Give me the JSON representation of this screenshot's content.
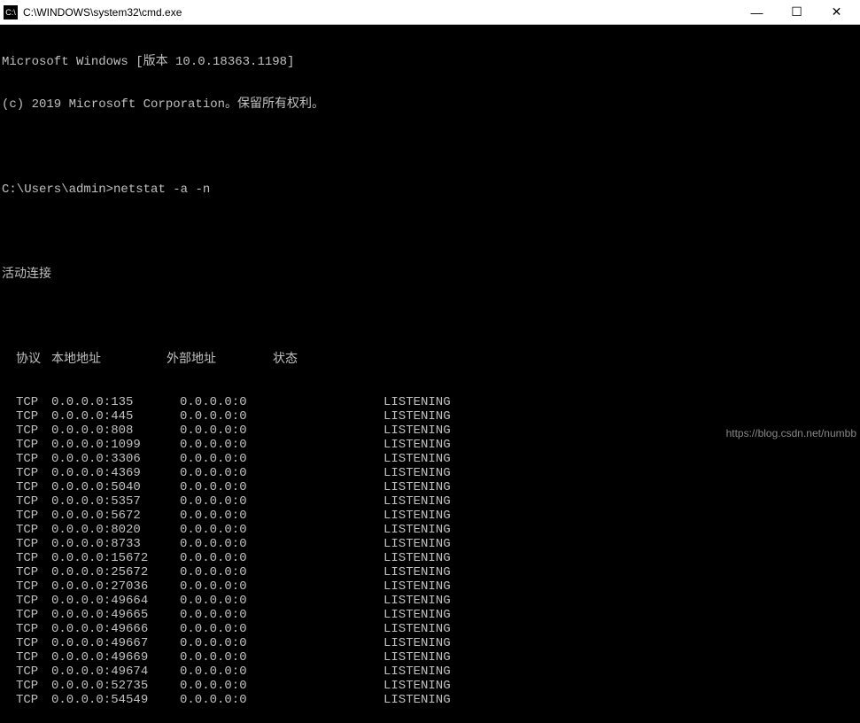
{
  "window": {
    "icon_label": "C:\\",
    "title": "C:\\WINDOWS\\system32\\cmd.exe",
    "minimize": "—",
    "maximize": "☐",
    "close": "✕"
  },
  "banner": {
    "line1": "Microsoft Windows [版本 10.0.18363.1198]",
    "line2": "(c) 2019 Microsoft Corporation。保留所有权利。"
  },
  "prompt": {
    "path": "C:\\Users\\admin>",
    "command": "netstat -a -n"
  },
  "section_title": "活动连接",
  "headers": {
    "proto": "协议",
    "local": "本地地址",
    "foreign": "外部地址",
    "state": "状态"
  },
  "rows": [
    {
      "proto": "TCP",
      "local": "0.0.0.0:135",
      "foreign": "0.0.0.0:0",
      "state": "LISTENING"
    },
    {
      "proto": "TCP",
      "local": "0.0.0.0:445",
      "foreign": "0.0.0.0:0",
      "state": "LISTENING"
    },
    {
      "proto": "TCP",
      "local": "0.0.0.0:808",
      "foreign": "0.0.0.0:0",
      "state": "LISTENING"
    },
    {
      "proto": "TCP",
      "local": "0.0.0.0:1099",
      "foreign": "0.0.0.0:0",
      "state": "LISTENING"
    },
    {
      "proto": "TCP",
      "local": "0.0.0.0:3306",
      "foreign": "0.0.0.0:0",
      "state": "LISTENING"
    },
    {
      "proto": "TCP",
      "local": "0.0.0.0:4369",
      "foreign": "0.0.0.0:0",
      "state": "LISTENING"
    },
    {
      "proto": "TCP",
      "local": "0.0.0.0:5040",
      "foreign": "0.0.0.0:0",
      "state": "LISTENING"
    },
    {
      "proto": "TCP",
      "local": "0.0.0.0:5357",
      "foreign": "0.0.0.0:0",
      "state": "LISTENING"
    },
    {
      "proto": "TCP",
      "local": "0.0.0.0:5672",
      "foreign": "0.0.0.0:0",
      "state": "LISTENING"
    },
    {
      "proto": "TCP",
      "local": "0.0.0.0:8020",
      "foreign": "0.0.0.0:0",
      "state": "LISTENING"
    },
    {
      "proto": "TCP",
      "local": "0.0.0.0:8733",
      "foreign": "0.0.0.0:0",
      "state": "LISTENING"
    },
    {
      "proto": "TCP",
      "local": "0.0.0.0:15672",
      "foreign": "0.0.0.0:0",
      "state": "LISTENING"
    },
    {
      "proto": "TCP",
      "local": "0.0.0.0:25672",
      "foreign": "0.0.0.0:0",
      "state": "LISTENING"
    },
    {
      "proto": "TCP",
      "local": "0.0.0.0:27036",
      "foreign": "0.0.0.0:0",
      "state": "LISTENING"
    },
    {
      "proto": "TCP",
      "local": "0.0.0.0:49664",
      "foreign": "0.0.0.0:0",
      "state": "LISTENING"
    },
    {
      "proto": "TCP",
      "local": "0.0.0.0:49665",
      "foreign": "0.0.0.0:0",
      "state": "LISTENING"
    },
    {
      "proto": "TCP",
      "local": "0.0.0.0:49666",
      "foreign": "0.0.0.0:0",
      "state": "LISTENING"
    },
    {
      "proto": "TCP",
      "local": "0.0.0.0:49667",
      "foreign": "0.0.0.0:0",
      "state": "LISTENING"
    },
    {
      "proto": "TCP",
      "local": "0.0.0.0:49669",
      "foreign": "0.0.0.0:0",
      "state": "LISTENING"
    },
    {
      "proto": "TCP",
      "local": "0.0.0.0:49674",
      "foreign": "0.0.0.0:0",
      "state": "LISTENING"
    },
    {
      "proto": "TCP",
      "local": "0.0.0.0:52735",
      "foreign": "0.0.0.0:0",
      "state": "LISTENING"
    },
    {
      "proto": "TCP",
      "local": "0.0.0.0:54549",
      "foreign": "0.0.0.0:0",
      "state": "LISTENING"
    }
  ],
  "watermark": "https://blog.csdn.net/numbb"
}
